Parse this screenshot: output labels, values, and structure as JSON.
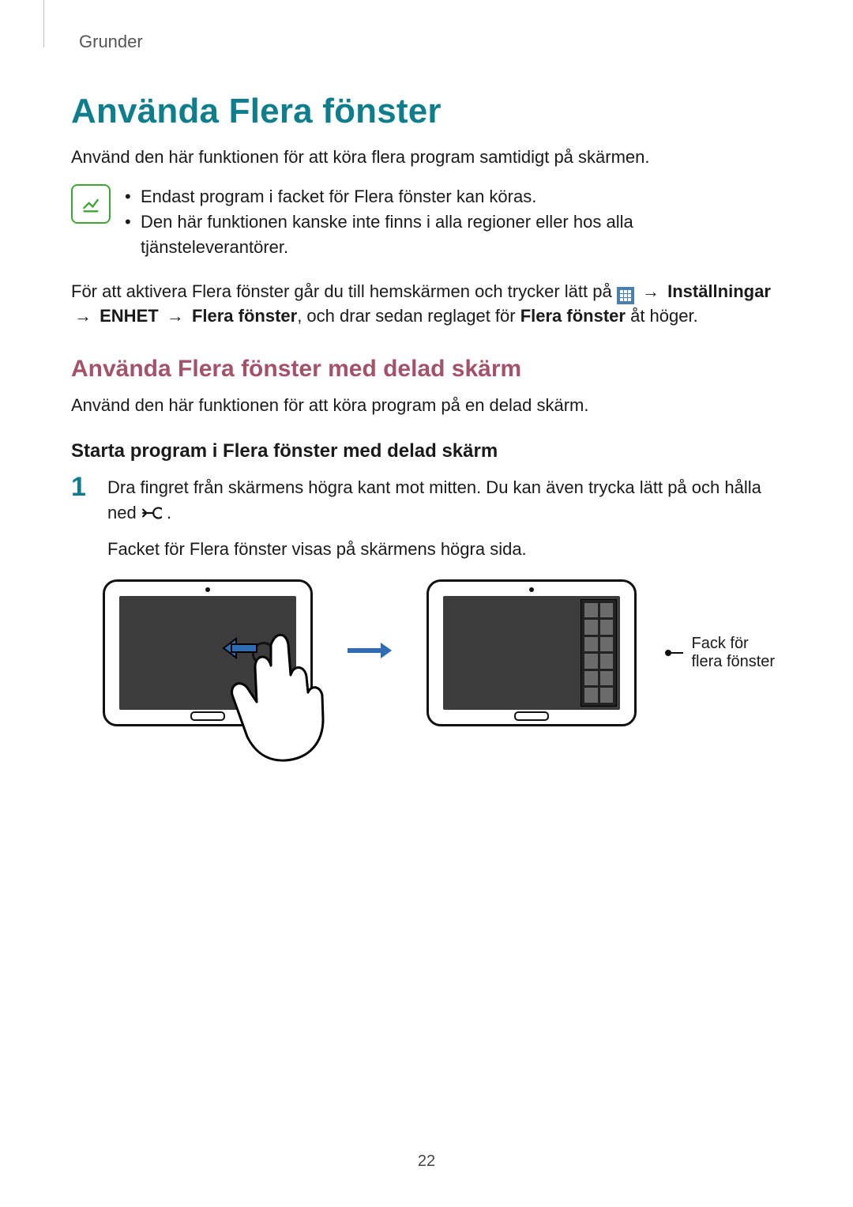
{
  "header": {
    "section": "Grunder"
  },
  "title": "Använda Flera fönster",
  "intro": "Använd den här funktionen för att köra flera program samtidigt på skärmen.",
  "notes": [
    "Endast program i facket för Flera fönster kan köras.",
    "Den här funktionen kanske inte finns i alla regioner eller hos alla tjänsteleverantörer."
  ],
  "activate": {
    "part1": "För att aktivera Flera fönster går du till hemskärmen och trycker lätt på ",
    "arrow": " → ",
    "settings": "Inställningar",
    "part2": "ENHET",
    "part3": "Flera fönster",
    "part4": ", och drar sedan reglaget för ",
    "part5": "Flera fönster",
    "part6": " åt höger."
  },
  "subheading": "Använda Flera fönster med delad skärm",
  "subintro": "Använd den här funktionen för att köra program på en delad skärm.",
  "h3": "Starta program i Flera fönster med delad skärm",
  "step1": {
    "num": "1",
    "line1a": "Dra fingret från skärmens högra kant mot mitten. Du kan även trycka lätt på och hålla ned ",
    "line1b": ".",
    "line2": "Facket för Flera fönster visas på skärmens högra sida."
  },
  "callout": "Fack för flera fönster",
  "pagenum": "22"
}
